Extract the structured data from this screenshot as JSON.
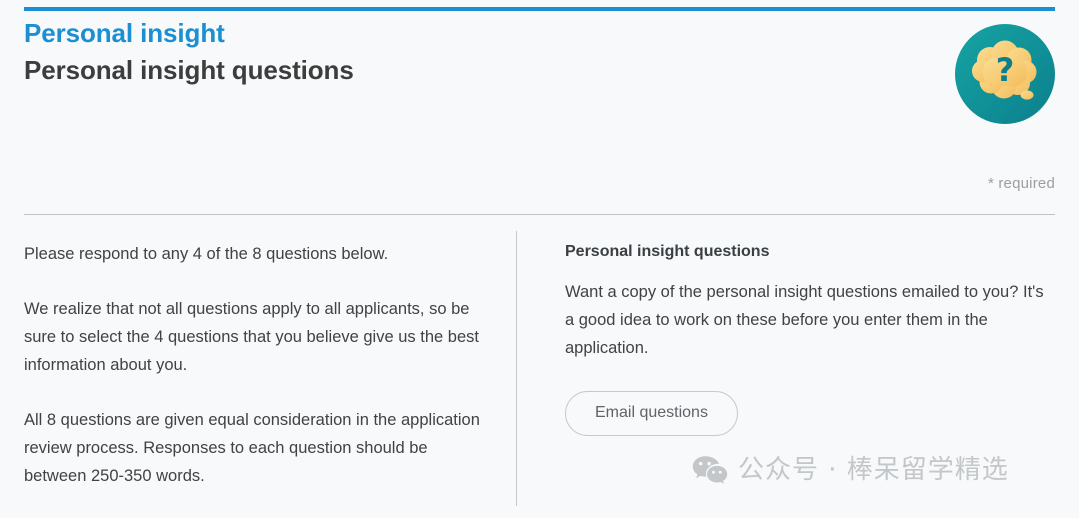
{
  "page": {
    "background_color": "#f7f9fa",
    "accent_color": "#1a8fd1"
  },
  "header": {
    "eyebrow": "Personal insight",
    "title": "Personal insight questions",
    "icon": "thought-bubble-question-icon",
    "icon_circle_color": "#0f8f96",
    "icon_bubble_color": "#f7cc74",
    "required_note": "* required"
  },
  "left_column": {
    "paragraphs": [
      "Please respond to any 4 of the 8 questions below.",
      "We realize that not all questions apply to all applicants, so be sure to select the 4 questions that you believe give us the best information about you.",
      "All 8 questions are given equal consideration in the application review process. Responses to each question should be between 250-350 words."
    ]
  },
  "right_column": {
    "heading": "Personal insight questions",
    "body": "Want a copy of the personal insight questions emailed to you? It's a good idea to work on these before you enter them in the application.",
    "button_label": "Email questions"
  },
  "watermark": {
    "icon": "wechat-icon",
    "text": "公众号 · 棒呆留学精选",
    "color": "#c3c7ca"
  }
}
